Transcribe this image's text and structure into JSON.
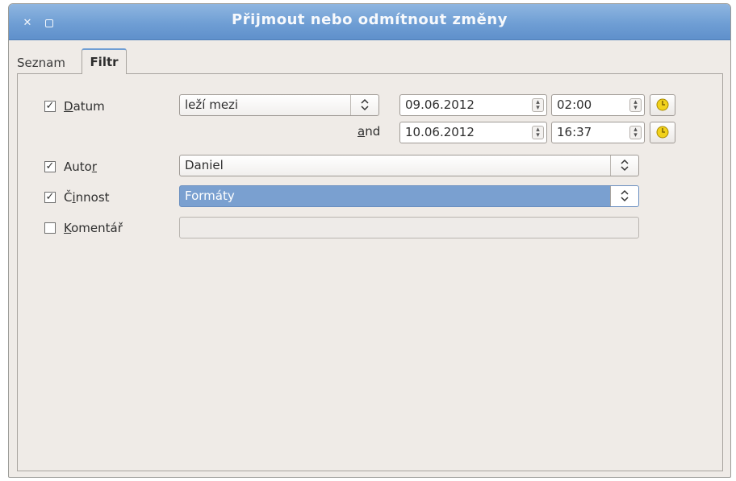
{
  "window": {
    "title": "Přijmout nebo odmítnout změny",
    "close_glyph": "✕",
    "icons": [
      "close-icon",
      "maximize-icon"
    ]
  },
  "tabs": [
    {
      "label": "Seznam",
      "active": false
    },
    {
      "label": "Filtr",
      "active": true
    }
  ],
  "filter": {
    "date": {
      "checked": true,
      "label_mnemonic": "D",
      "label_rest": "atum",
      "condition": "leží mezi",
      "start_date": "09.06.2012",
      "start_time": "02:00",
      "and_mnemonic": "a",
      "and_rest": "nd",
      "end_date": "10.06.2012",
      "end_time": "16:37"
    },
    "author": {
      "checked": true,
      "label_prefix": "Auto",
      "label_mnemonic": "r",
      "value": "Daniel"
    },
    "action": {
      "checked": true,
      "label_prefix": "Č",
      "label_mnemonic": "i",
      "label_rest": "nnost",
      "value": "Formáty"
    },
    "comment": {
      "checked": false,
      "label_mnemonic": "K",
      "label_rest": "omentář",
      "value": ""
    }
  },
  "glyphs": {
    "check": "✓",
    "combo_arrows": "⌃⌄",
    "spin_up": "▴",
    "spin_down": "▾"
  },
  "colors": {
    "titlebar": "#6f9ed4",
    "selection": "#7aa0d0",
    "clock_icon": "#f2d21c"
  }
}
